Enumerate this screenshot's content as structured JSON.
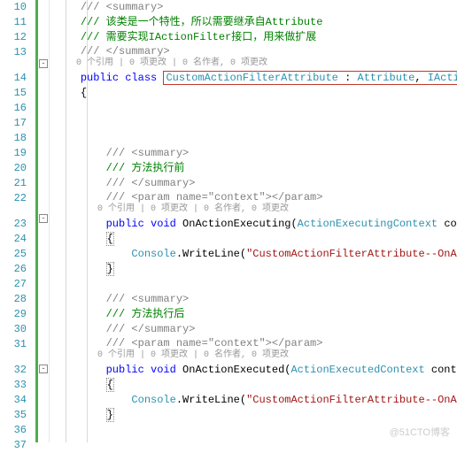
{
  "lineNumbers": [
    "10",
    "11",
    "12",
    "13",
    "",
    "14",
    "15",
    "16",
    "17",
    "18",
    "19",
    "20",
    "21",
    "22",
    "",
    "23",
    "24",
    "25",
    "26",
    "27",
    "28",
    "29",
    "30",
    "31",
    "",
    "32",
    "33",
    "34",
    "35",
    "36",
    "37"
  ],
  "codeLens": {
    "line13": "0 个引用 | 0 项更改 | 0 名作者, 0 项更改",
    "line22": "0 个引用 | 0 项更改 | 0 名作者, 0 项更改",
    "line31": "0 个引用 | 0 项更改 | 0 名作者, 0 项更改"
  },
  "doc": {
    "summaryOpen": "/// <summary>",
    "line11": "/// 该类是一个特性，所以需要继承自Attribute",
    "line12": "/// 需要实现IActionFilter接口，用来做扩展",
    "summaryClose": "/// </summary>",
    "line20": "/// 方法执行前",
    "param": "/// <param name=\"context\"></param>",
    "line29": "/// 方法执行后"
  },
  "kw": {
    "public": "public",
    "class": "class",
    "void": "void"
  },
  "types": {
    "CustomActionFilterAttribute": "CustomActionFilterAttribute",
    "Attribute": "Attribute",
    "IActionFilter": "IActionFilter",
    "ActionExecutingContext": "ActionExecutingContext",
    "ActionExecutedContext": "ActionExecutedContext",
    "Console": "Console"
  },
  "members": {
    "OnActionExecuting": "OnActionExecuting",
    "OnActionExecuted": "OnActionExecuted",
    "WriteLine": "WriteLine"
  },
  "ident": {
    "context": "context"
  },
  "strings": {
    "executing": "\"CustomActionFilterAttribute--OnActionExecuting\"",
    "executed": "\"CustomActionFilterAttribute--OnActionExecuted\""
  },
  "punct": {
    "obrace": "{",
    "cbrace": "}",
    "colon": " : ",
    "comma": ", ",
    "oparen": "(",
    "cparen": ")",
    "dot": ".",
    "semi": ";",
    "space": " "
  },
  "watermark": "@51CTO博客"
}
